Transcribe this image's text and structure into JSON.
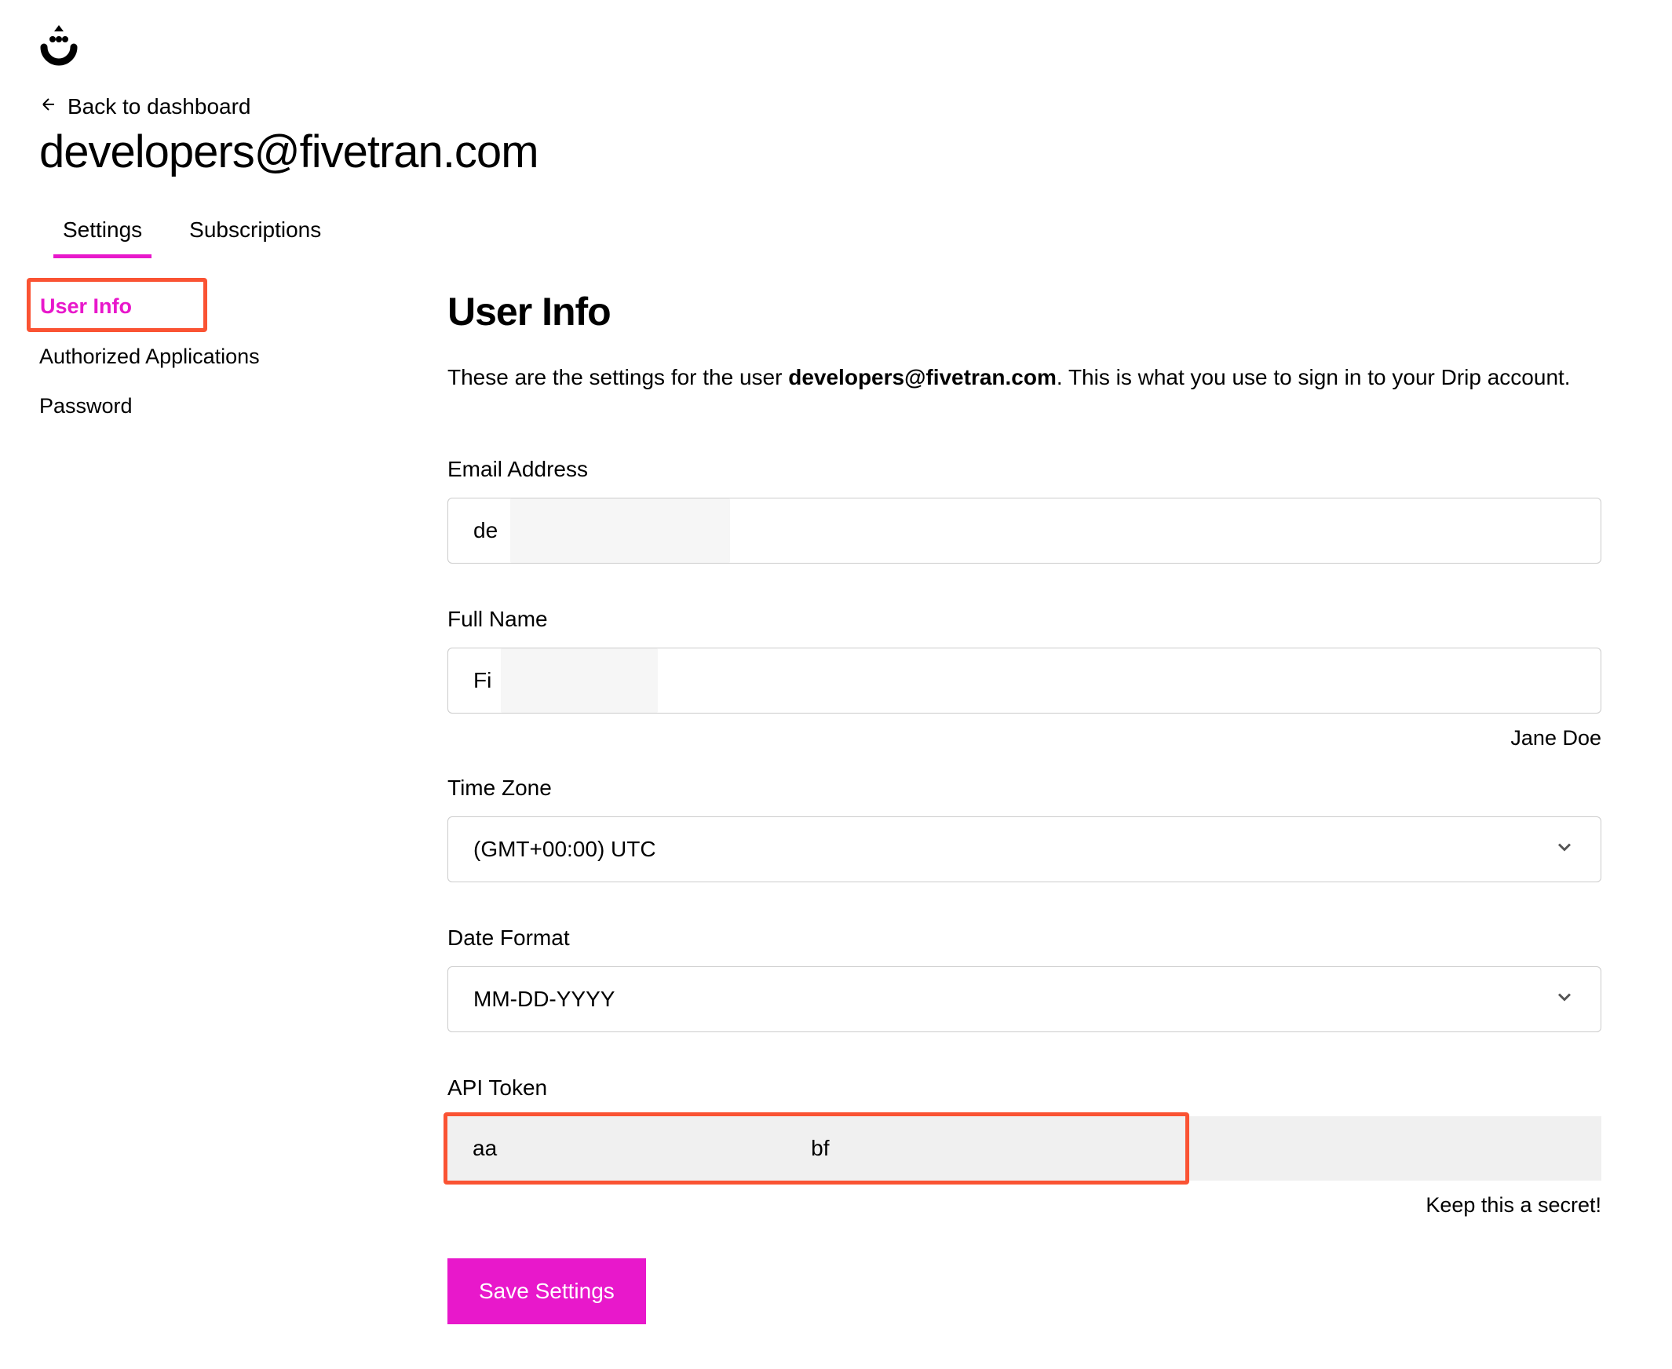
{
  "header": {
    "back_label": "Back to dashboard",
    "page_title": "developers@fivetran.com"
  },
  "tabs": [
    {
      "label": "Settings",
      "active": true
    },
    {
      "label": "Subscriptions",
      "active": false
    }
  ],
  "sidebar": {
    "items": [
      {
        "label": "User Info",
        "active": true
      },
      {
        "label": "Authorized Applications",
        "active": false
      },
      {
        "label": "Password",
        "active": false
      }
    ]
  },
  "main": {
    "section_title": "User Info",
    "description_prefix": "These are the settings for the user ",
    "description_email": "developers@fivetran.com",
    "description_suffix": ". This is what you use to sign in to your Drip account.",
    "fields": {
      "email": {
        "label": "Email Address",
        "value": "de"
      },
      "full_name": {
        "label": "Full Name",
        "value": "Fi",
        "helper": "Jane Doe"
      },
      "timezone": {
        "label": "Time Zone",
        "value": "(GMT+00:00) UTC"
      },
      "date_format": {
        "label": "Date Format",
        "value": "MM-DD-YYYY"
      },
      "api_token": {
        "label": "API Token",
        "value_part1": "aa",
        "value_part2": "bf",
        "helper": "Keep this a secret!"
      }
    },
    "save_button": "Save Settings"
  },
  "icons": {
    "back_arrow": "arrow-left-icon",
    "chevron": "chevron-down-icon",
    "logo": "drip-logo"
  }
}
